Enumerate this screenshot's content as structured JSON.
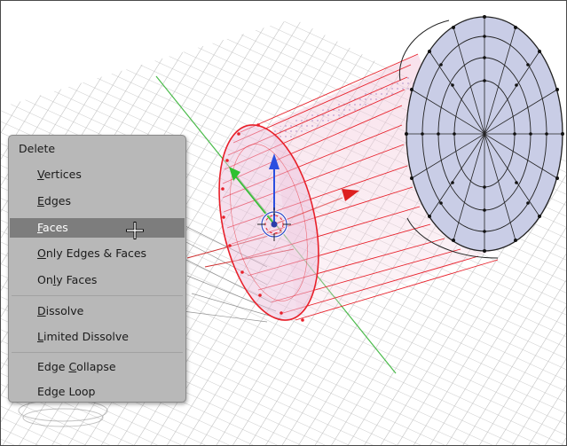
{
  "menu": {
    "title": "Delete",
    "items": [
      {
        "pre": "",
        "mn": "V",
        "post": "ertices"
      },
      {
        "pre": "",
        "mn": "E",
        "post": "dges"
      },
      {
        "pre": "",
        "mn": "F",
        "post": "aces"
      },
      {
        "pre": "",
        "mn": "O",
        "post": "nly Edges & Faces"
      },
      {
        "pre": "On",
        "mn": "l",
        "post": "y Faces"
      },
      {
        "pre": "",
        "mn": "D",
        "post": "issolve"
      },
      {
        "pre": "",
        "mn": "L",
        "post": "imited Dissolve"
      },
      {
        "pre": "Edge ",
        "mn": "C",
        "post": "ollapse"
      },
      {
        "pre": "Ed",
        "mn": "g",
        "post": "e Loop"
      }
    ],
    "active_index": 2
  },
  "colors": {
    "selected_wire": "#e8202a",
    "face_fill": "#c9cde6",
    "grid": "#9a9a9a",
    "axis_x": "#d03030",
    "axis_y": "#30b030",
    "gizmo_z": "#2a4ee0",
    "gizmo_y": "#30c030",
    "gizmo_x": "#dd2020",
    "menu_bg": "#b8b8b8",
    "menu_highlight": "#7d7d7d"
  },
  "icons": [
    "transform-gizmo-icon",
    "move-cursor-icon",
    "3d-cursor-icon"
  ]
}
